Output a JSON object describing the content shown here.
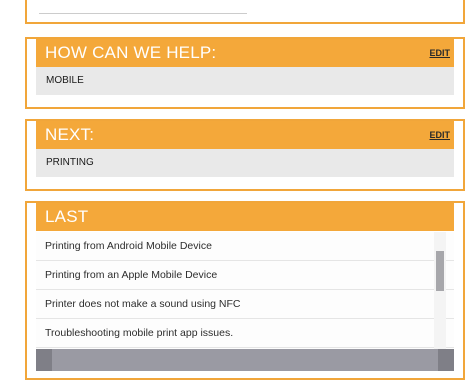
{
  "sections": {
    "help": {
      "title": "HOW CAN WE HELP:",
      "edit_label": "EDIT",
      "value": "MOBILE"
    },
    "next": {
      "title": "NEXT:",
      "edit_label": "EDIT",
      "value": "PRINTING"
    },
    "last": {
      "title": "LAST",
      "items": [
        "Printing from Android Mobile Device",
        "Printing from an Apple Mobile Device",
        "Printer does not make a sound using NFC",
        "Troubleshooting mobile print app issues."
      ]
    }
  },
  "colors": {
    "accent": "#f4a83a",
    "border": "#f1a63a",
    "value_bg": "#e9e9e9",
    "scrollbar": "#9a9aa3"
  }
}
